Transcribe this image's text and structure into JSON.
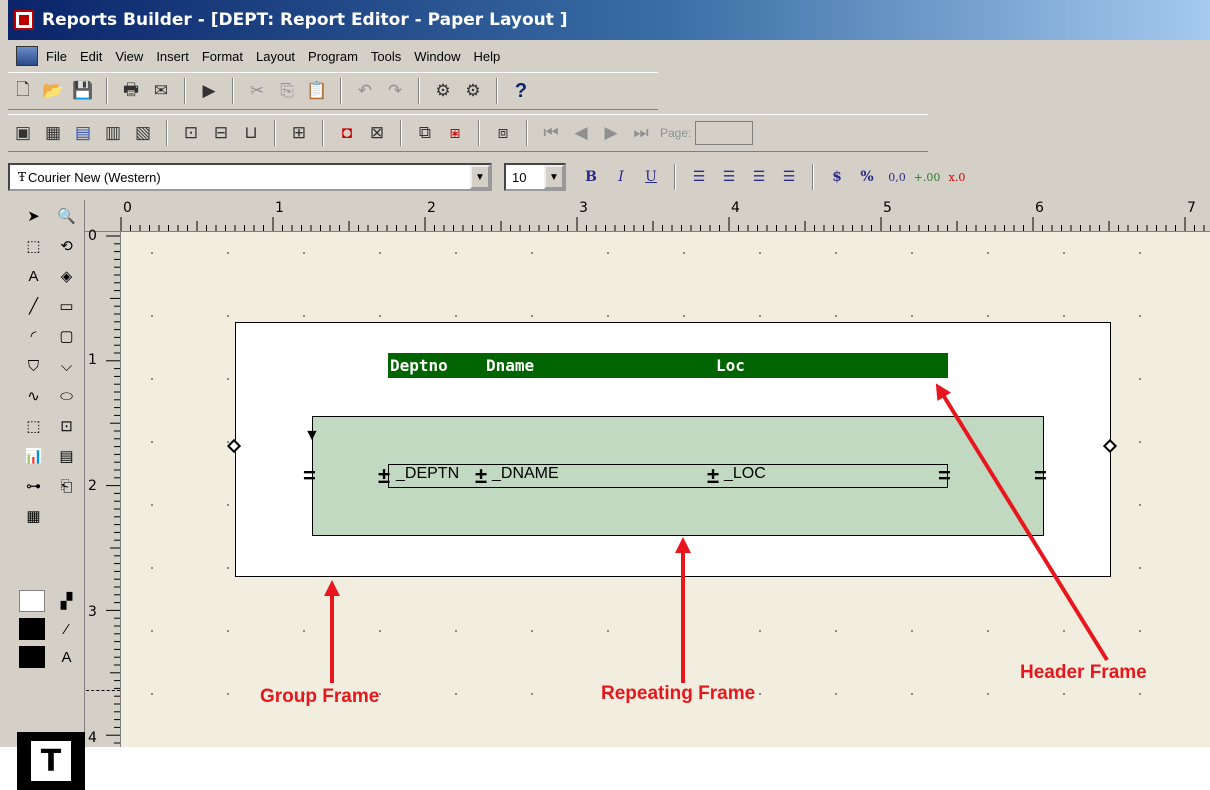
{
  "window": {
    "title": "Reports Builder - [DEPT: Report Editor - Paper Layout ]"
  },
  "menu": [
    "File",
    "Edit",
    "View",
    "Insert",
    "Format",
    "Layout",
    "Program",
    "Tools",
    "Window",
    "Help"
  ],
  "navigation": {
    "page_label": "Page:"
  },
  "font": {
    "name": "Courier New (Western)",
    "size": "10"
  },
  "format_buttons": {
    "bold": "B",
    "italic": "I",
    "underline": "U",
    "currency": "$",
    "percent": "%",
    "commas": "0,0",
    "add_decimal": "+.00",
    "remove_decimal": "x.0"
  },
  "help_button": "?",
  "ruler": {
    "h": [
      "0",
      "1",
      "2",
      "3",
      "4",
      "5",
      "6",
      "7"
    ],
    "v": [
      "0",
      "1",
      "2",
      "3",
      "4"
    ]
  },
  "layout": {
    "header": {
      "deptno": "Deptno",
      "dname": "Dname",
      "loc": "Loc"
    },
    "fields": {
      "deptno": "_DEPTN",
      "dname": "_DNAME",
      "loc": "_LOC"
    }
  },
  "annotations": {
    "group_frame": "Group Frame",
    "repeating_frame": "Repeating Frame",
    "header_frame": "Header Frame"
  },
  "colors": {
    "header_fill": "#006400",
    "repeating_fill": "#c1d9c1",
    "annotation": "#e8171d"
  }
}
